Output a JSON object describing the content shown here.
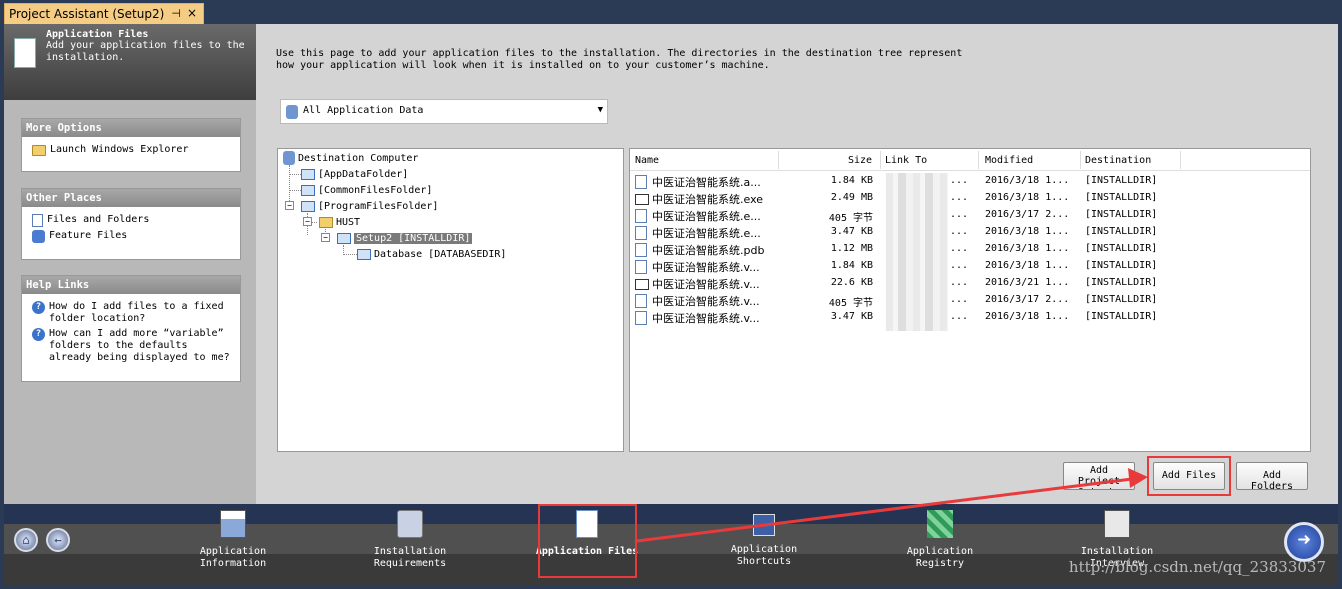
{
  "window": {
    "tab_title": "Project Assistant (Setup2)",
    "pin_glyph": "⊣",
    "close_glyph": "×"
  },
  "sidebar": {
    "header_title": "Application Files",
    "header_desc": "Add your application files to the installation.",
    "more_options": {
      "title": "More Options",
      "items": [
        "Launch Windows Explorer"
      ]
    },
    "other_places": {
      "title": "Other Places",
      "items": [
        "Files and Folders",
        "Feature Files"
      ]
    },
    "help_links": {
      "title": "Help Links",
      "items": [
        "How do I add files to a fixed folder location?",
        "How can I add more “variable” folders to the defaults already being displayed to me?"
      ]
    }
  },
  "main": {
    "intro": "Use this page to add your application files to the installation. The directories in the destination tree represent how your application will look when it is installed on to your customer’s machine.",
    "filter_dropdown": "All Application Data",
    "tree": {
      "root": "Destination Computer",
      "n1": "[AppDataFolder]",
      "n2": "[CommonFilesFolder]",
      "n3": "[ProgramFilesFolder]",
      "n4": "HUST",
      "n5": "Setup2 [INSTALLDIR]",
      "n6": "Database [DATABASEDIR]"
    },
    "file_columns": [
      "Name",
      "Size",
      "Link To",
      "Modified",
      "Destination"
    ],
    "files": [
      {
        "name": "中医证治智能系统.a...",
        "size": "1.84 KB",
        "link": "...",
        "modified": "2016/3/18 1...",
        "dest": "[INSTALLDIR]",
        "icon": "file"
      },
      {
        "name": "中医证治智能系统.exe",
        "size": "2.49 MB",
        "link": "...",
        "modified": "2016/3/18 1...",
        "dest": "[INSTALLDIR]",
        "icon": "window"
      },
      {
        "name": "中医证治智能系统.e...",
        "size": "405 字节",
        "link": "...",
        "modified": "2016/3/17 2...",
        "dest": "[INSTALLDIR]",
        "icon": "file"
      },
      {
        "name": "中医证治智能系统.e...",
        "size": "3.47 KB",
        "link": "...",
        "modified": "2016/3/18 1...",
        "dest": "[INSTALLDIR]",
        "icon": "file"
      },
      {
        "name": "中医证治智能系统.pdb",
        "size": "1.12 MB",
        "link": "...",
        "modified": "2016/3/18 1...",
        "dest": "[INSTALLDIR]",
        "icon": "file"
      },
      {
        "name": "中医证治智能系统.v...",
        "size": "1.84 KB",
        "link": "...",
        "modified": "2016/3/18 1...",
        "dest": "[INSTALLDIR]",
        "icon": "file"
      },
      {
        "name": "中医证治智能系统.v...",
        "size": "22.6 KB",
        "link": "...",
        "modified": "2016/3/21 1...",
        "dest": "[INSTALLDIR]",
        "icon": "window"
      },
      {
        "name": "中医证治智能系统.v...",
        "size": "405 字节",
        "link": "...",
        "modified": "2016/3/17 2...",
        "dest": "[INSTALLDIR]",
        "icon": "file"
      },
      {
        "name": "中医证治智能系统.v...",
        "size": "3.47 KB",
        "link": "...",
        "modified": "2016/3/18 1...",
        "dest": "[INSTALLDIR]",
        "icon": "file"
      }
    ],
    "buttons": {
      "add_project_outputs": "Add Project Outputs",
      "add_files": "Add Files",
      "add_folders": "Add Folders"
    }
  },
  "nav": {
    "steps": [
      {
        "label": "Application Information",
        "icon": "app-info-icon"
      },
      {
        "label": "Installation Requirements",
        "icon": "requirements-icon"
      },
      {
        "label": "Application Files",
        "icon": "page-icon"
      },
      {
        "label": "Application Shortcuts",
        "icon": "shortcut-icon"
      },
      {
        "label": "Application Registry",
        "icon": "registry-icon"
      },
      {
        "label": "Installation Interview",
        "icon": "interview-icon"
      }
    ],
    "home_glyph": "⌂",
    "back_glyph": "←",
    "next_glyph": "➜"
  },
  "watermark": "http://blog.csdn.net/qq_23833037",
  "colors": {
    "highlight": "#e83a3a",
    "tab": "#f5cc84",
    "nav_bg": "#2b3a55"
  }
}
